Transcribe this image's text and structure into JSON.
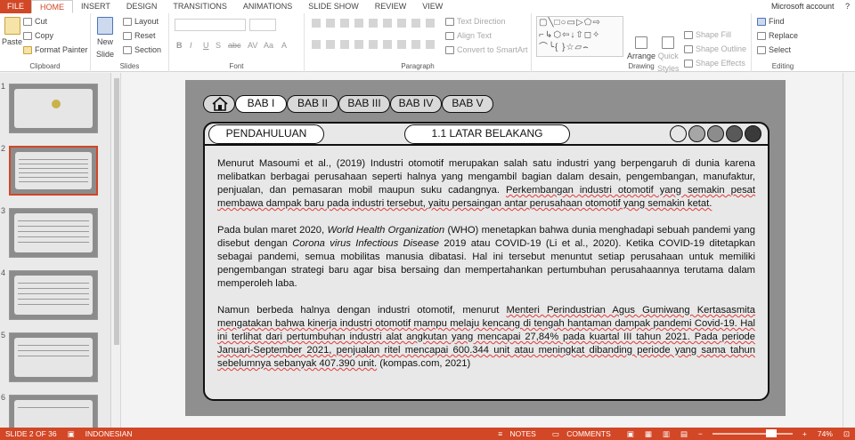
{
  "ribbon_tabs": [
    {
      "label": "FILE"
    },
    {
      "label": "HOME"
    },
    {
      "label": "INSERT"
    },
    {
      "label": "DESIGN"
    },
    {
      "label": "TRANSITIONS"
    },
    {
      "label": "ANIMATIONS"
    },
    {
      "label": "SLIDE SHOW"
    },
    {
      "label": "REVIEW"
    },
    {
      "label": "VIEW"
    }
  ],
  "account": "Microsoft account",
  "help": "?",
  "clipboard": {
    "paste": "Paste",
    "cut": "Cut",
    "copy": "Copy",
    "format_painter": "Format Painter",
    "label": "Clipboard"
  },
  "slides_group": {
    "new_slide": "New",
    "new_slide2": "Slide",
    "layout": "Layout",
    "reset": "Reset",
    "section": "Section",
    "label": "Slides"
  },
  "font_group": {
    "label": "Font",
    "buttons": [
      "B",
      "I",
      "U",
      "S",
      "abc",
      "AV",
      "Aa",
      "A"
    ]
  },
  "paragraph_group": {
    "label": "Paragraph",
    "text_direction": "Text Direction",
    "align_text": "Align Text",
    "smartart": "Convert to SmartArt"
  },
  "drawing_group": {
    "label": "Drawing",
    "arrange": "Arrange",
    "quick_styles": "Quick",
    "quick_styles2": "Styles",
    "shape_fill": "Shape Fill",
    "shape_outline": "Shape Outline",
    "shape_effects": "Shape Effects"
  },
  "editing_group": {
    "label": "Editing",
    "find": "Find",
    "replace": "Replace",
    "select": "Select"
  },
  "thumb_numbers": [
    "1",
    "2",
    "3",
    "4",
    "5",
    "6"
  ],
  "slide": {
    "nav": [
      "BAB I",
      "BAB II",
      "BAB III",
      "BAB IV",
      "BAB V"
    ],
    "section": "PENDAHULUAN",
    "subsection": "1.1 LATAR BELAKANG",
    "dot_colors": [
      "#e6e6e6",
      "#a6a6a6",
      "#8c8c8c",
      "#595959",
      "#3a3a3a"
    ],
    "p1_a": "Menurut Masoumi et al., (2019) Industri otomotif merupakan salah satu industri yang berpengaruh di dunia karena melibatkan berbagai perusahaan seperti halnya yang mengambil bagian dalam desain, pengembangan, manufaktur, penjualan, dan pemasaran mobil maupun suku cadangnya. ",
    "p1_b": "Perkembangan industri otomotif yang semakin pesat membawa dampak baru pada industri tersebut, yaitu persaingan antar perusahaan otomotif yang semakin ketat.",
    "p2_a": "Pada bulan maret 2020, ",
    "p2_em1": "World Health Organization",
    "p2_b": " (WHO) menetapkan bahwa dunia menghadapi sebuah pandemi yang disebut dengan ",
    "p2_em2": "Corona virus Infectious Disease",
    "p2_c": " 2019 atau COVID-19 (Li et al., 2020). Ketika COVID-19 ditetapkan sebagai pandemi, semua mobilitas manusia dibatasi. Hal ini tersebut menuntut setiap perusahaan untuk memiliki pengembangan strategi baru agar bisa bersaing dan mempertahankan pertumbuhan perusahaannya terutama dalam memperoleh laba.",
    "p3_a": "Namun berbeda halnya dengan industri otomotif, menurut ",
    "p3_b": "Menteri Perindustrian Agus Gumiwang Kertasasmita mengatakan bahwa kinerja industri otomotif mampu melaju kencang di tengah hantaman dampak pandemi Covid-19. Hal ini terlihat dari pertumbuhan industri alat angkutan yang mencapai 27,84% pada kuartal III tahun 2021. Pada periode Januari-September 2021, penjualan ritel mencapai 600.344 unit atau meningkat dibanding periode yang sama tahun sebelumnya sebanyak 407.390 unit.",
    "p3_c": " (kompas.com, 2021)"
  },
  "status": {
    "slide_info": "SLIDE 2 OF 36",
    "language": "INDONESIAN",
    "notes": "NOTES",
    "comments": "COMMENTS",
    "zoom": "74%"
  },
  "colors": {
    "accent": "#d24726",
    "slide_bg": "#8f8f8f",
    "panel": "#e8e8e8"
  }
}
